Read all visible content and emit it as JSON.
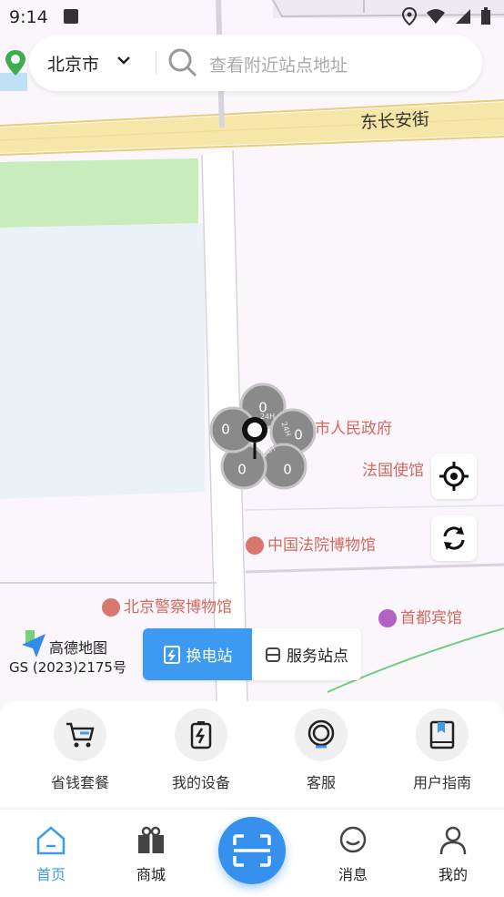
{
  "status_bar": {
    "time": "9:14"
  },
  "search": {
    "city": "北京市",
    "placeholder": "查看附近站点地址"
  },
  "map": {
    "street_label": "东长安街",
    "pois": [
      "市人民政府",
      "法国使馆",
      "中国法院博物馆",
      "北京警察博物馆",
      "首都宾馆"
    ],
    "attribution_name": "高德地图",
    "attribution_code": "GS (2023)2175号",
    "cluster_counts": [
      "0",
      "0",
      "0",
      "0",
      "0"
    ],
    "cluster_tags": [
      "24H",
      "24H",
      "24H"
    ]
  },
  "station_toggle": {
    "active": "换电站",
    "inactive": "服务站点"
  },
  "quick_actions": [
    {
      "label": "省钱套餐",
      "icon": "cart-icon"
    },
    {
      "label": "我的设备",
      "icon": "battery-icon"
    },
    {
      "label": "客服",
      "icon": "headset-icon"
    },
    {
      "label": "用户指南",
      "icon": "book-icon"
    }
  ],
  "tabs": [
    {
      "label": "首页",
      "icon": "home-icon",
      "active": true
    },
    {
      "label": "商城",
      "icon": "gift-icon"
    },
    {
      "label": "消息",
      "icon": "message-icon"
    },
    {
      "label": "我的",
      "icon": "user-icon"
    }
  ],
  "colors": {
    "accent": "#3d9af1",
    "poi_text": "#d06a5f",
    "road_yellow": "#f6e7a8"
  }
}
